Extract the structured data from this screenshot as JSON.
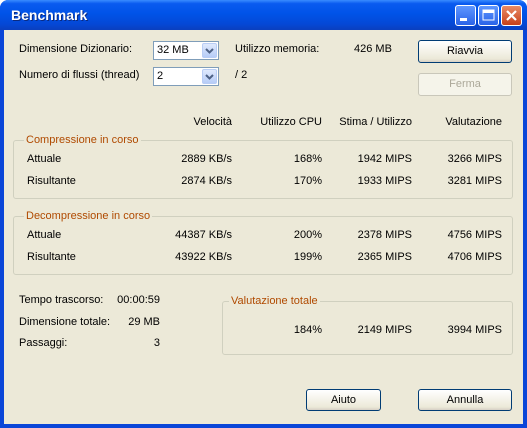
{
  "window": {
    "title": "Benchmark"
  },
  "settings": {
    "dict_label": "Dimensione Dizionario:",
    "dict_value": "32 MB",
    "threads_label": "Numero di flussi (thread)",
    "threads_value": "2",
    "threads_max": "/ 2",
    "memory_label": "Utilizzo memoria:",
    "memory_value": "426 MB"
  },
  "buttons": {
    "restart": "Riavvia",
    "stop": "Ferma",
    "help": "Aiuto",
    "cancel": "Annulla"
  },
  "columns": [
    "Velocità",
    "Utilizzo CPU",
    "Stima / Utilizzo",
    "Valutazione"
  ],
  "compression": {
    "title": "Compressione in corso",
    "rows": [
      {
        "label": "Attuale",
        "speed": "2889 KB/s",
        "cpu": "168%",
        "estimate": "1942 MIPS",
        "rating": "3266 MIPS"
      },
      {
        "label": "Risultante",
        "speed": "2874 KB/s",
        "cpu": "170%",
        "estimate": "1933 MIPS",
        "rating": "3281 MIPS"
      }
    ]
  },
  "decompression": {
    "title": "Decompressione in corso",
    "rows": [
      {
        "label": "Attuale",
        "speed": "44387 KB/s",
        "cpu": "200%",
        "estimate": "2378 MIPS",
        "rating": "4756 MIPS"
      },
      {
        "label": "Risultante",
        "speed": "43922 KB/s",
        "cpu": "199%",
        "estimate": "2365 MIPS",
        "rating": "4706 MIPS"
      }
    ]
  },
  "stats": {
    "elapsed_label": "Tempo trascorso:",
    "elapsed_value": "00:00:59",
    "size_label": "Dimensione totale:",
    "size_value": "29 MB",
    "passes_label": "Passaggi:",
    "passes_value": "3"
  },
  "total": {
    "title": "Valutazione totale",
    "cpu": "184%",
    "estimate": "2149 MIPS",
    "rating": "3994 MIPS"
  },
  "colors": {
    "titlebar": "#0054e3",
    "dialog_bg": "#ece9d8",
    "group_title_blue": "#0046d5",
    "group_title_brown": "#b04a00",
    "close_button": "#d8532c"
  },
  "icons": [
    "minimize-icon",
    "maximize-icon",
    "close-icon",
    "chevron-down-icon"
  ]
}
